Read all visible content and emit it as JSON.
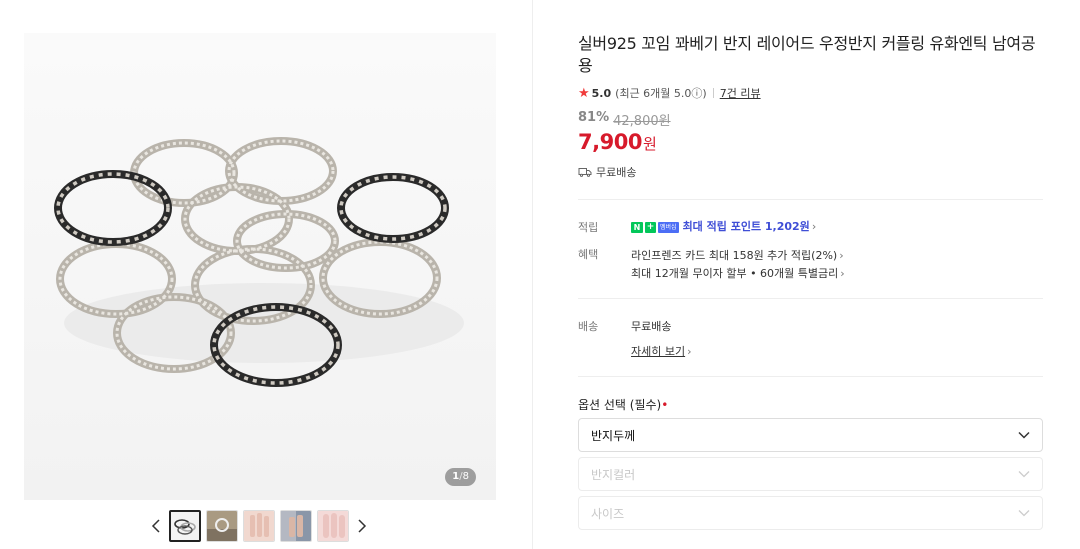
{
  "gallery": {
    "page_current": "1",
    "page_total": "8",
    "thumb_count": 5,
    "prev_icon": "chevron-left-icon",
    "next_icon": "chevron-right-icon"
  },
  "product": {
    "title": "실버925 꼬임 꽈베기 반지 레이어드 우정반지 커플링 유화엔틱 남여공용",
    "rating": {
      "star_icon": "star-icon",
      "star_color": "#f03b3b",
      "score": "5.0",
      "recent": "(최근 6개월 5.0ⓘ)",
      "reviews": "7건 리뷰"
    },
    "discount_rate": "81%",
    "original_price": "42,800원",
    "price": "7,900",
    "price_unit": "원",
    "price_color": "#d71a2b",
    "shipping_badge": "무료배송"
  },
  "benefits": {
    "points_label": "적립",
    "npay_n": "N",
    "npay_plus": "+",
    "npay_member": "멤버십",
    "points_text": "최대 적립 포인트 1,202원",
    "benefit_label": "혜택",
    "card_text": "라인프렌즈 카드 최대 158원 추가 적립(2%)",
    "installment_text": "최대 12개월 무이자 할부 • 60개월 특별금리"
  },
  "delivery": {
    "label": "배송",
    "value": "무료배송",
    "detail_link": "자세히 보기"
  },
  "options": {
    "title": "옵션 선택 (필수)",
    "required_mark": "•",
    "selects": [
      {
        "label": "반지두께",
        "enabled": true
      },
      {
        "label": "반지컬러",
        "enabled": false
      },
      {
        "label": "사이즈",
        "enabled": false
      }
    ]
  }
}
